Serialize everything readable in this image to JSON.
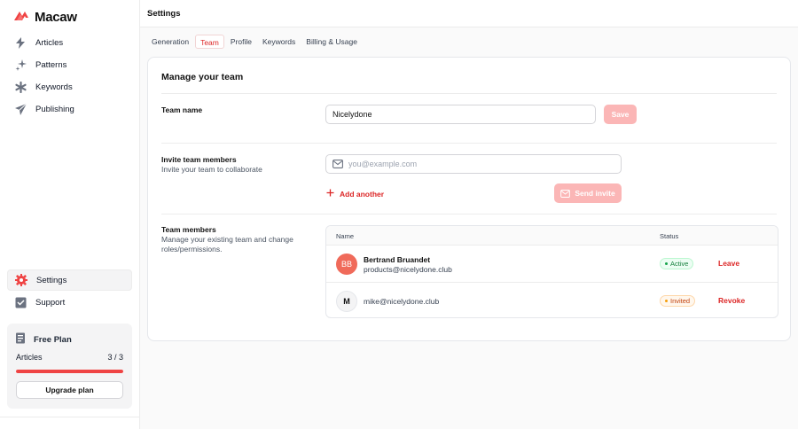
{
  "app": {
    "name": "Macaw"
  },
  "sidebar": {
    "nav": [
      {
        "label": "Articles",
        "icon": "lightning-icon"
      },
      {
        "label": "Patterns",
        "icon": "sparkles-icon"
      },
      {
        "label": "Keywords",
        "icon": "asterisk-icon"
      },
      {
        "label": "Publishing",
        "icon": "send-icon"
      }
    ],
    "bottom_nav": [
      {
        "label": "Settings",
        "icon": "gear-icon",
        "active": true
      },
      {
        "label": "Support",
        "icon": "support-icon"
      }
    ],
    "plan": {
      "title": "Free Plan",
      "usage_label": "Articles",
      "usage_value": "3 / 3",
      "usage_fraction": 1.0,
      "button": "Upgrade plan"
    }
  },
  "header": {
    "title": "Settings"
  },
  "tabs": [
    {
      "label": "Generation"
    },
    {
      "label": "Team",
      "active": true
    },
    {
      "label": "Profile"
    },
    {
      "label": "Keywords"
    },
    {
      "label": "Billing & Usage"
    }
  ],
  "team": {
    "title": "Manage your team",
    "name_section": {
      "label": "Team name",
      "value": "Nicelydone",
      "save": "Save"
    },
    "invite_section": {
      "label": "Invite team members",
      "desc": "Invite your team to collaborate",
      "placeholder": "you@example.com",
      "add_another": "Add another",
      "send": "Send invite"
    },
    "members_section": {
      "label": "Team members",
      "desc": "Manage your existing team and change roles/permissions.",
      "columns": {
        "name": "Name",
        "status": "Status"
      },
      "rows": [
        {
          "initials": "BB",
          "name": "Bertrand Bruandet",
          "email": "products@nicelydone.club",
          "status": "Active",
          "action": "Leave"
        },
        {
          "initials": "M",
          "name": "",
          "email": "mike@nicelydone.club",
          "status": "Invited",
          "action": "Revoke"
        }
      ]
    }
  },
  "colors": {
    "accent": "#dc2626",
    "accent_light": "#fbb6b6",
    "active_badge": "#15803d",
    "invited_badge": "#c2410c"
  }
}
